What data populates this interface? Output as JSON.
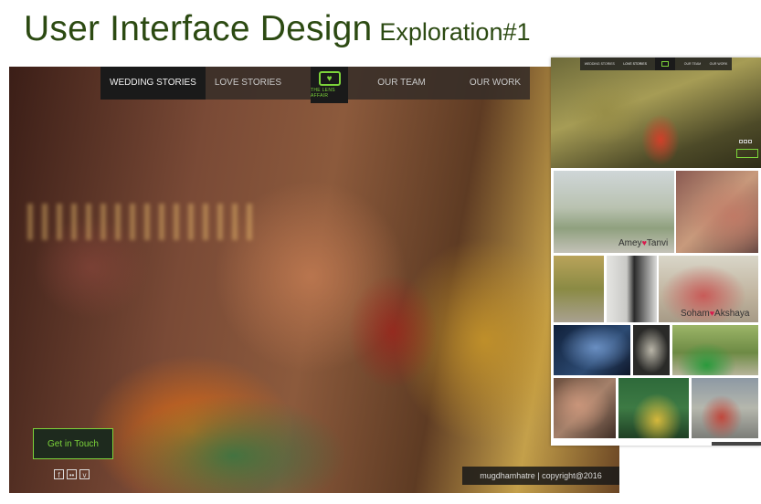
{
  "heading": {
    "title": "User Interface Design",
    "subtitle": "Exploration#1",
    "color": "#2c4a12"
  },
  "main_mockup": {
    "nav": {
      "items_left": [
        "WEDDING STORIES",
        "LOVE STORIES"
      ],
      "logo_text": "THE LENS AFFAIR",
      "logo_icon": "camera-heart-icon",
      "items_right": [
        "OUR TEAM",
        "OUR WORK"
      ]
    },
    "cta_label": "Get in Touch",
    "social_icons": [
      "facebook-icon",
      "flickr-icon",
      "vimeo-icon"
    ],
    "social_glyphs": [
      "f",
      "••",
      "v"
    ],
    "copyright": "mugdhamhatre | copyright@2016",
    "accent_color": "#7cd33a"
  },
  "side_mockup": {
    "captions": [
      {
        "left": "Amey",
        "right": "Tanvi"
      },
      {
        "left": "Soham",
        "right": "Akshaya"
      }
    ],
    "heart_glyph": "♥"
  }
}
